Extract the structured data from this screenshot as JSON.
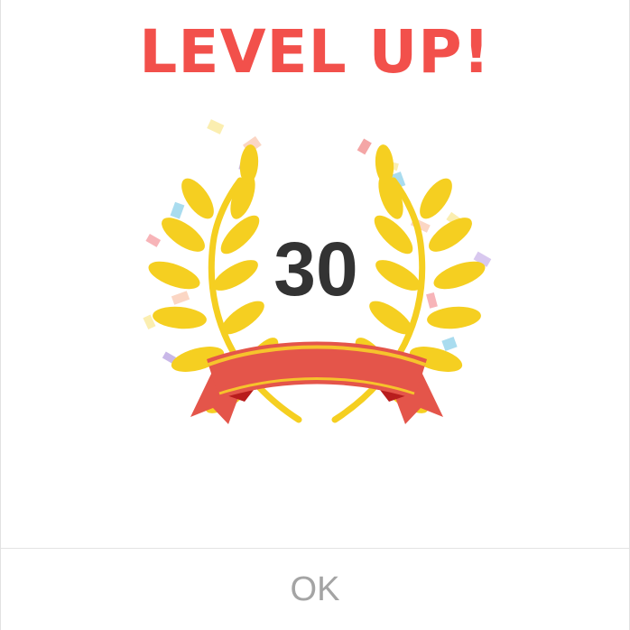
{
  "dialog": {
    "title": "LEVEL UP!",
    "level": "30",
    "ok_label": "OK"
  },
  "colors": {
    "title": "#f2504b",
    "laurel": "#f5cf21",
    "ribbon": "#e4554a",
    "ribbon_stripe": "#f6c32c",
    "level_text": "#333333",
    "ok_text": "#a4a4a4"
  },
  "icons": [
    "laurel-wreath-icon",
    "ribbon-banner-icon",
    "confetti-icon"
  ]
}
